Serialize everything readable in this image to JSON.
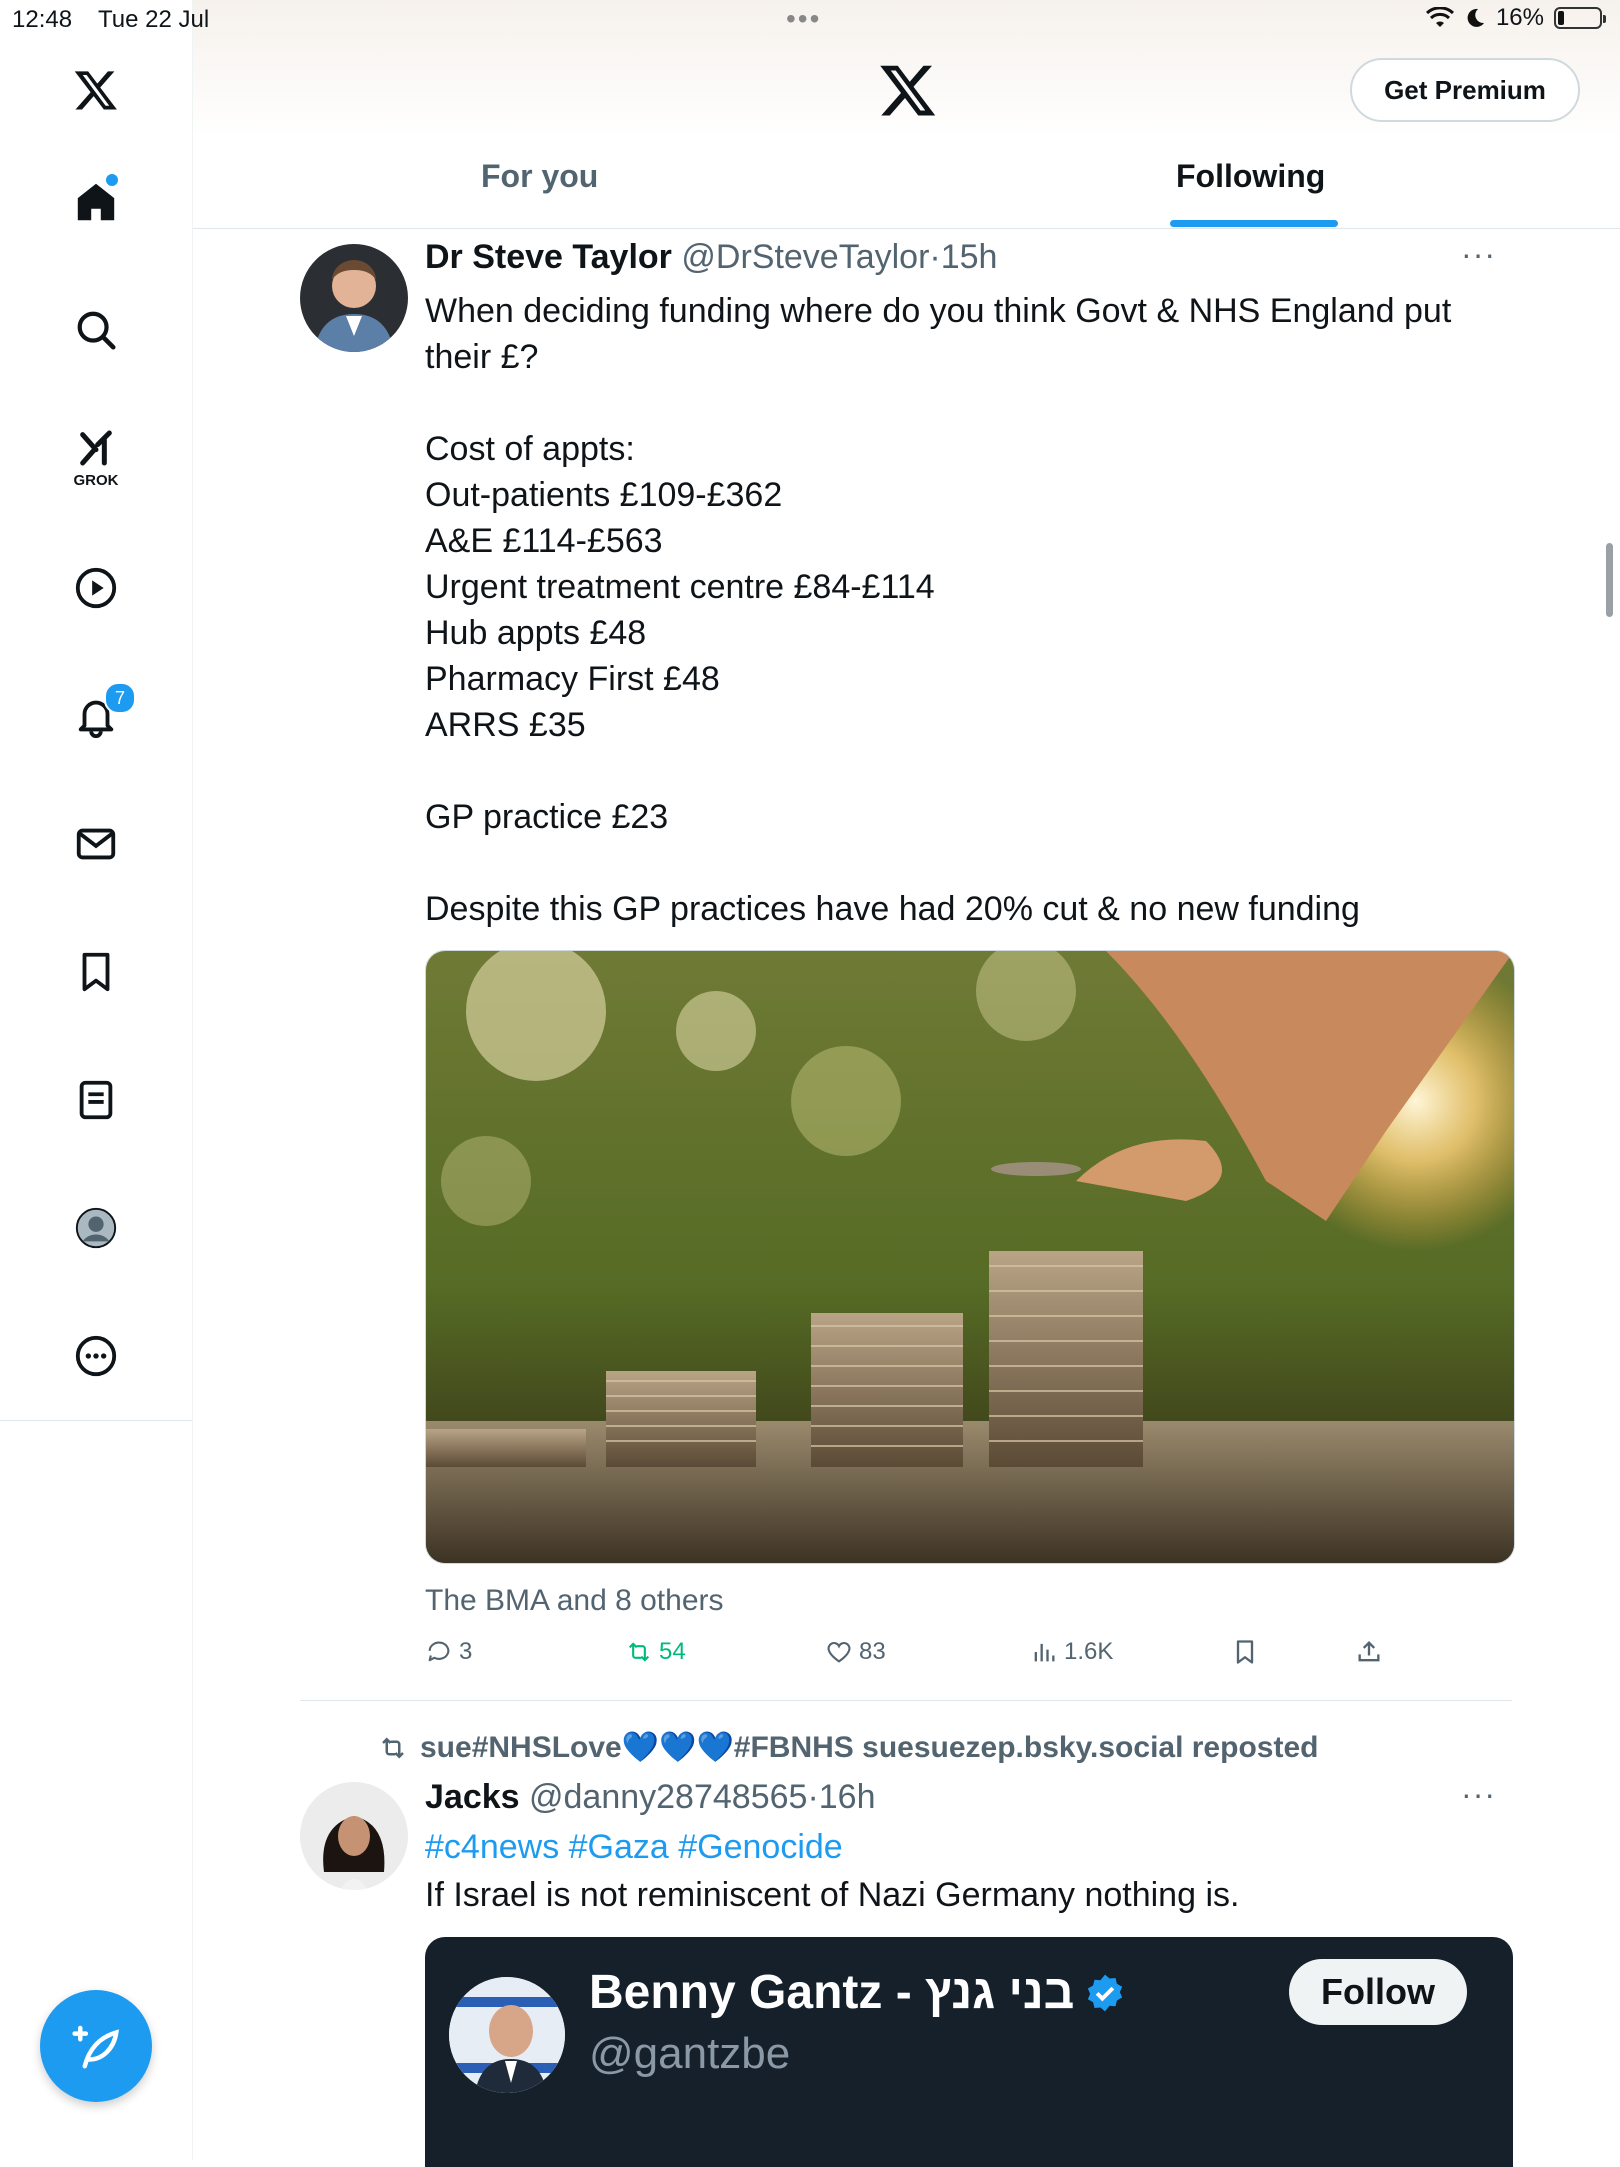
{
  "status_bar": {
    "time": "12:48",
    "date": "Tue 22 Jul",
    "dots": "•••",
    "battery": "16%"
  },
  "header": {
    "premium_label": "Get Premium",
    "tabs": [
      {
        "label": "For you"
      },
      {
        "label": "Following"
      }
    ]
  },
  "sidebar": {
    "grok_label": "GROK",
    "notifications_count": "7"
  },
  "tweets": [
    {
      "name": "Dr Steve Taylor",
      "handle": "@DrSteveTaylor",
      "time": "·15h",
      "more": "···",
      "text": "When deciding funding where do you think Govt & NHS England put their £?\n\nCost of appts:\nOut-patients £109-£362\nA&E £114-£563\nUrgent treatment centre £84-£114\nHub appts £48\nPharmacy First £48\nARRS £35\n\nGP practice £23\n\nDespite this GP practices have had 20% cut & no new funding",
      "social_context": "The BMA and 8 others",
      "replies": "3",
      "reposts": "54",
      "likes": "83",
      "views": "1.6K"
    },
    {
      "repost_by": "sue#NHSLove💙💙💙#FBNHS suesuezep.bsky.social reposted",
      "name": "Jacks",
      "handle": "@danny28748565",
      "time": "·16h",
      "more": "···",
      "hashtags": "#c4news #Gaza #Genocide",
      "text": "If Israel is not reminiscent of Nazi Germany nothing is.",
      "embed": {
        "name": "Benny Gantz - בני גנץ",
        "handle": "@gantzbe",
        "follow_label": "Follow"
      }
    }
  ],
  "colors": {
    "accent": "#1d9bf0",
    "repost_active": "#00ba7c",
    "text": "#0f1419",
    "muted": "#536471"
  }
}
